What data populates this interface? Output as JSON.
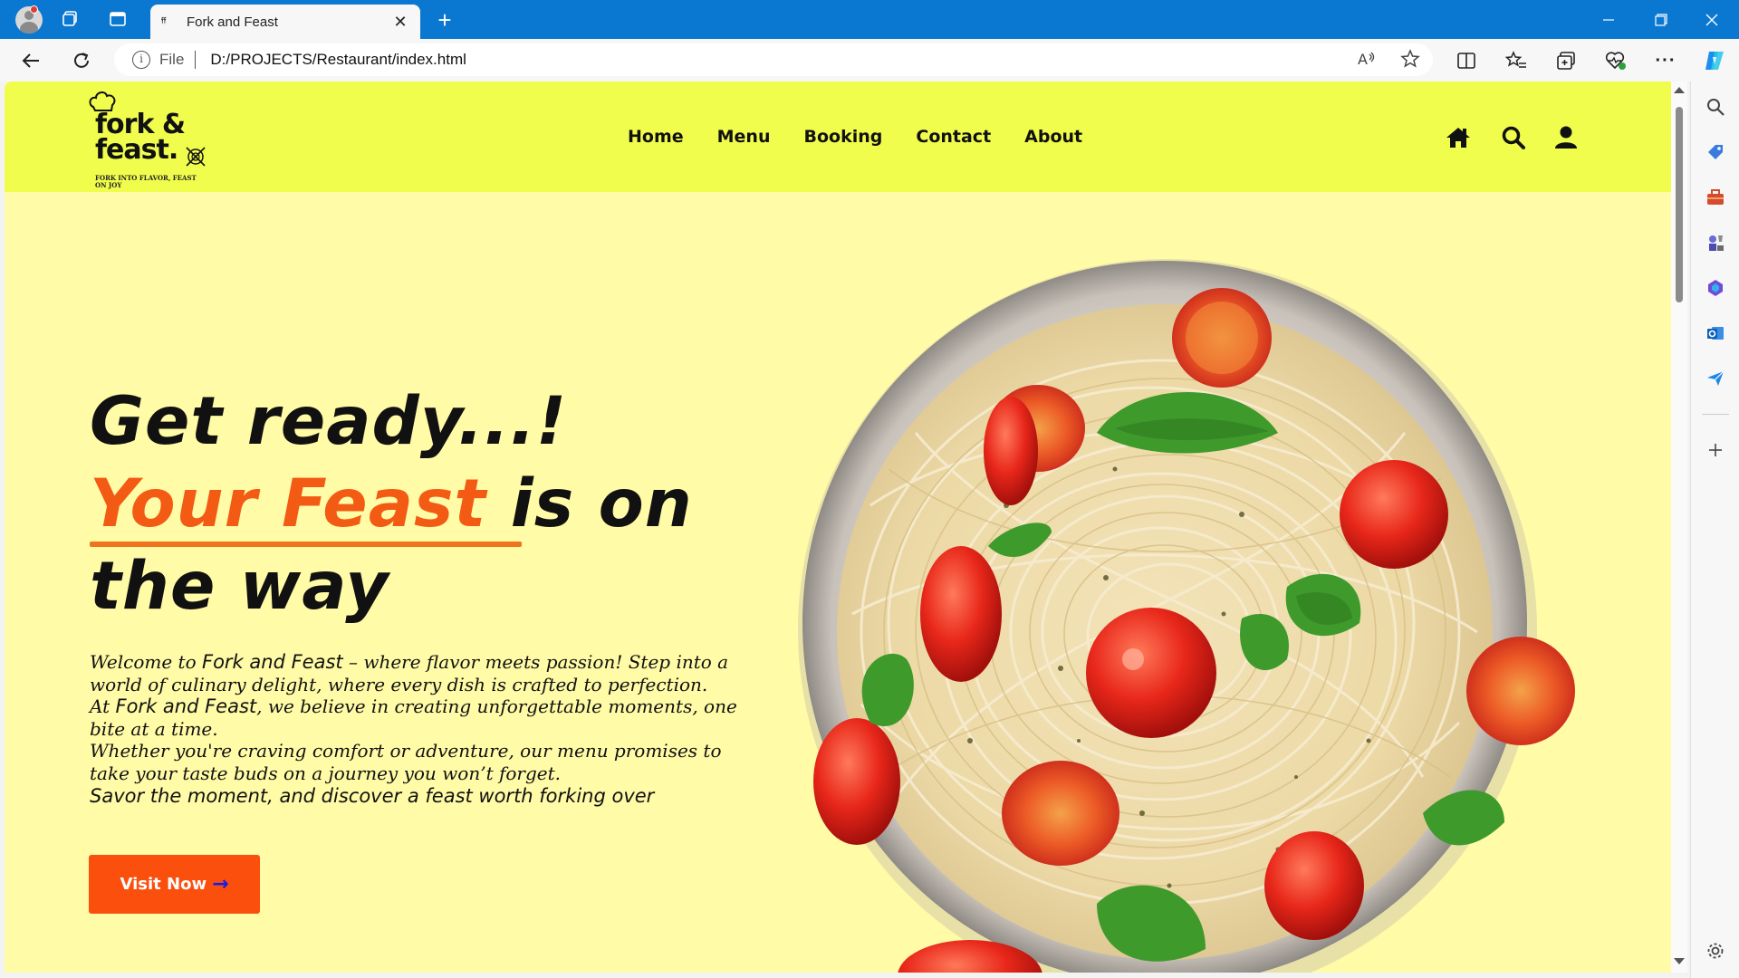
{
  "browser": {
    "tab_title": "Fork and Feast",
    "address_prefix": "File",
    "url": "D:/PROJECTS/Restaurant/index.html"
  },
  "site": {
    "logo": {
      "line1": "fork &",
      "line2": "feast.",
      "tagline": "FORK INTO FLAVOR, FEAST ON JOY"
    },
    "nav": [
      "Home",
      "Menu",
      "Booking",
      "Contact",
      "About"
    ],
    "header_icons": [
      "home-icon",
      "search-icon",
      "user-icon"
    ],
    "hero": {
      "title_line1": "Get ready...!",
      "title_accent": "Your Feast ",
      "title_line2_rest": "is on",
      "title_line3": "the way",
      "para1_a": "Welcome to ",
      "para1_brand": "Fork and Feast",
      "para1_b": " – where flavor meets passion! Step into a world of culinary delight, where every dish is crafted to perfection.",
      "para2_a": "At ",
      "para2_brand": "Fork and Feast",
      "para2_b": ", we believe in creating unforgettable moments, one bite at a time.",
      "para3": "Whether you're craving comfort or adventure, our menu promises to take your taste buds on a journey you won’t forget.",
      "para4": "Savor the moment, and discover a feast worth forking over",
      "button_label": "Visit Now",
      "button_arrow": "→"
    },
    "colors": {
      "header_bg": "#f1fd4c",
      "page_bg": "#fffba6",
      "accent": "#f35a13",
      "button": "#fb4f0e"
    }
  }
}
